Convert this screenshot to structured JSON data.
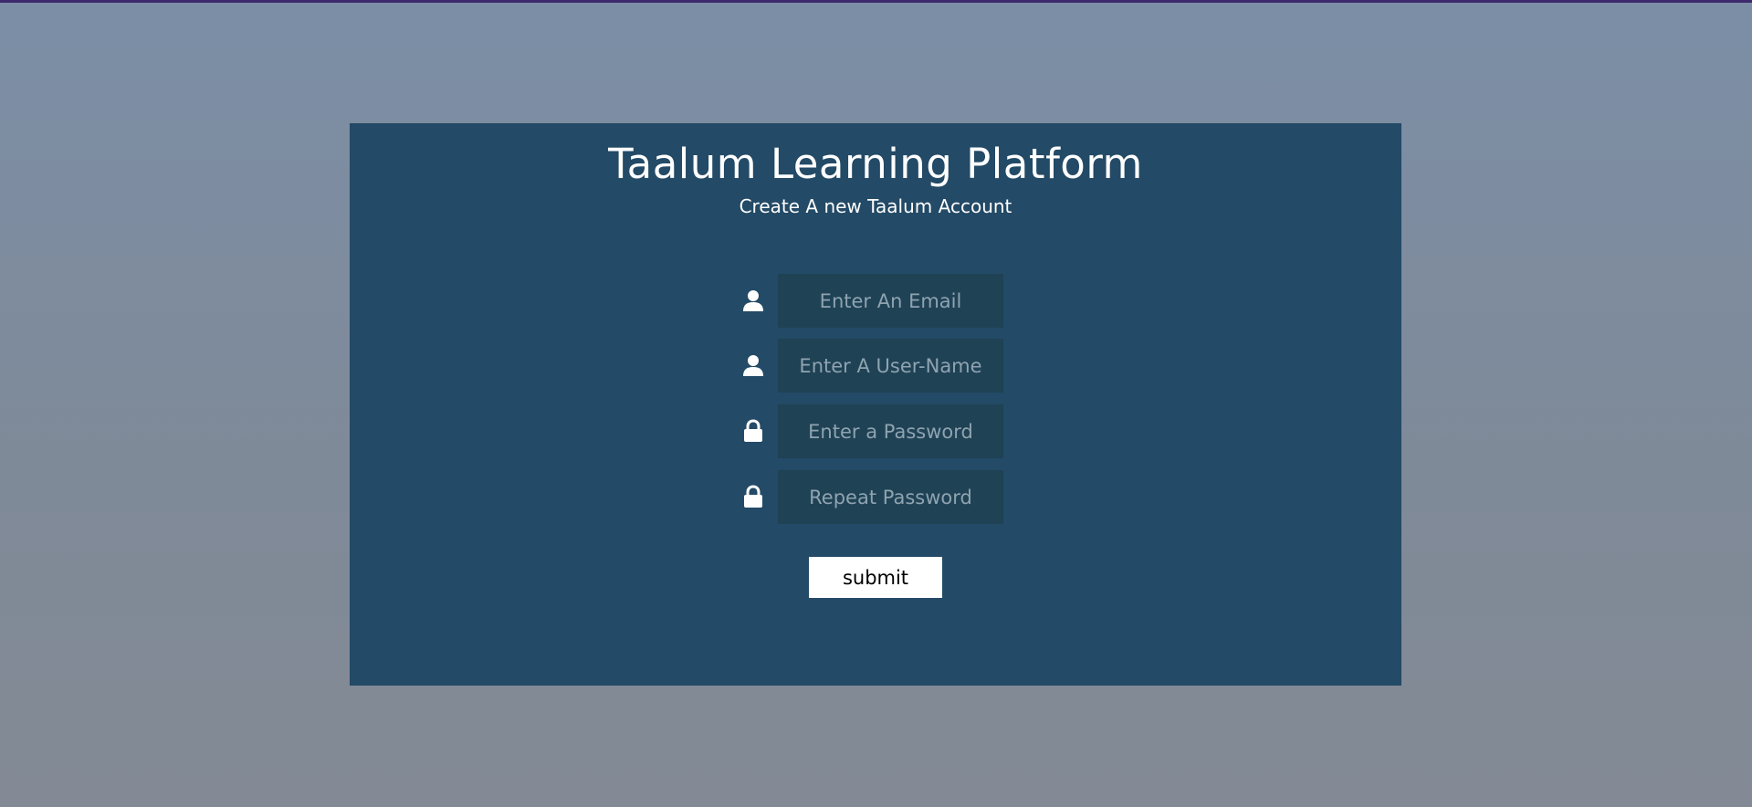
{
  "colors": {
    "page_background": "#7f8c9e",
    "top_strip": "#3d2a6e",
    "panel": "#234a66",
    "input_background": "#1f4255",
    "placeholder_text": "#8fa3b0",
    "text": "#ffffff"
  },
  "header": {
    "title": "Taalum Learning Platform",
    "subtitle": "Create A new Taalum Account"
  },
  "form": {
    "fields": [
      {
        "icon": "user-icon",
        "placeholder": "Enter An Email",
        "value": ""
      },
      {
        "icon": "user-icon",
        "placeholder": "Enter A User-Name",
        "value": ""
      },
      {
        "icon": "lock-icon",
        "placeholder": "Enter a Password",
        "value": ""
      },
      {
        "icon": "lock-icon",
        "placeholder": "Repeat Password",
        "value": ""
      }
    ],
    "submit_label": "submit"
  }
}
